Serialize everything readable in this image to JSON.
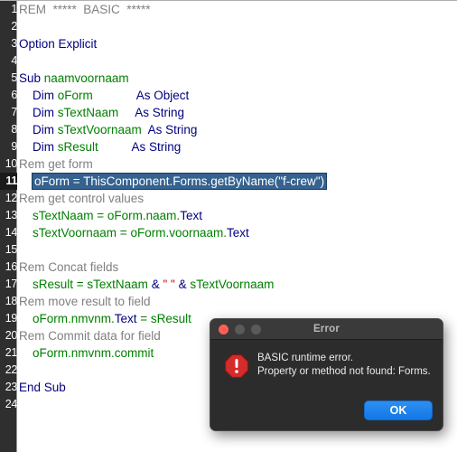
{
  "editor": {
    "name": "basic-code-editor",
    "colors": {
      "background": "#ffffff",
      "gutter_background": "#2f2f2f",
      "gutter_text": "#ffffff",
      "keyword": "#00007f",
      "identifier": "#008000",
      "comment": "#808080",
      "string": "#cc0000",
      "selection": "#35628f"
    },
    "active_line": 11,
    "lines": [
      {
        "no": "1",
        "tokens": [
          {
            "t": "REM  *****  BASIC  *****",
            "c": "rem"
          }
        ]
      },
      {
        "no": "2",
        "tokens": []
      },
      {
        "no": "3",
        "tokens": [
          {
            "t": "Option Explicit",
            "c": "kw"
          }
        ]
      },
      {
        "no": "4",
        "tokens": []
      },
      {
        "no": "5",
        "tokens": [
          {
            "t": "Sub ",
            "c": "kw"
          },
          {
            "t": "naamvoornaam",
            "c": "id"
          }
        ]
      },
      {
        "no": "6",
        "tokens": [
          {
            "t": "    Dim ",
            "c": "kw"
          },
          {
            "t": "oForm",
            "c": "id"
          },
          {
            "t": "             ",
            "c": "op"
          },
          {
            "t": "As Object",
            "c": "kw"
          }
        ]
      },
      {
        "no": "7",
        "tokens": [
          {
            "t": "    Dim ",
            "c": "kw"
          },
          {
            "t": "sTextNaam",
            "c": "id"
          },
          {
            "t": "     ",
            "c": "op"
          },
          {
            "t": "As String",
            "c": "kw"
          }
        ]
      },
      {
        "no": "8",
        "tokens": [
          {
            "t": "    Dim ",
            "c": "kw"
          },
          {
            "t": "sTextVoornaam",
            "c": "id"
          },
          {
            "t": "  ",
            "c": "op"
          },
          {
            "t": "As String",
            "c": "kw"
          }
        ]
      },
      {
        "no": "9",
        "tokens": [
          {
            "t": "    Dim ",
            "c": "kw"
          },
          {
            "t": "sResult",
            "c": "id"
          },
          {
            "t": "          ",
            "c": "op"
          },
          {
            "t": "As String",
            "c": "kw"
          }
        ]
      },
      {
        "no": "10",
        "tokens": [
          {
            "t": "Rem get form",
            "c": "rem"
          }
        ]
      },
      {
        "no": "11",
        "selected": true,
        "sel_indent": "    ",
        "tokens": [
          {
            "t": "oForm = ThisComponent.Forms.getByName(\"f-crew\")",
            "c": "id"
          }
        ]
      },
      {
        "no": "12",
        "tokens": [
          {
            "t": "Rem get control values",
            "c": "rem"
          }
        ]
      },
      {
        "no": "13",
        "tokens": [
          {
            "t": "    sTextNaam = oForm.naam.",
            "c": "id"
          },
          {
            "t": "Text",
            "c": "kw"
          }
        ]
      },
      {
        "no": "14",
        "tokens": [
          {
            "t": "    sTextVoornaam = oForm.voornaam.",
            "c": "id"
          },
          {
            "t": "Text",
            "c": "kw"
          }
        ]
      },
      {
        "no": "15",
        "tokens": []
      },
      {
        "no": "16",
        "tokens": [
          {
            "t": "Rem Concat fields",
            "c": "rem"
          }
        ]
      },
      {
        "no": "17",
        "tokens": [
          {
            "t": "    sResult = sTextNaam ",
            "c": "id"
          },
          {
            "t": "&",
            "c": "kw"
          },
          {
            "t": " ",
            "c": "id"
          },
          {
            "t": "\" \"",
            "c": "str"
          },
          {
            "t": " ",
            "c": "id"
          },
          {
            "t": "&",
            "c": "kw"
          },
          {
            "t": " sTextVoornaam",
            "c": "id"
          }
        ]
      },
      {
        "no": "18",
        "tokens": [
          {
            "t": "Rem move result to field",
            "c": "rem"
          }
        ]
      },
      {
        "no": "19",
        "tokens": [
          {
            "t": "    oForm.nmvnm.",
            "c": "id"
          },
          {
            "t": "Text",
            "c": "kw"
          },
          {
            "t": " = sResult",
            "c": "id"
          }
        ]
      },
      {
        "no": "20",
        "tokens": [
          {
            "t": "Rem Commit data for field",
            "c": "rem"
          }
        ]
      },
      {
        "no": "21",
        "tokens": [
          {
            "t": "    oForm.nmvnm.commit",
            "c": "id"
          }
        ]
      },
      {
        "no": "22",
        "tokens": []
      },
      {
        "no": "23",
        "tokens": [
          {
            "t": "End Sub",
            "c": "kw"
          }
        ]
      },
      {
        "no": "24",
        "tokens": []
      }
    ]
  },
  "dialog": {
    "title": "Error",
    "icon": "error-stop-icon",
    "message_line1": "BASIC runtime error.",
    "message_line2": "Property or method not found: Forms.",
    "ok_label": "OK",
    "colors": {
      "window": "#2c2c2c",
      "titlebar": "#3a3a3a",
      "close_button": "#ff5f57",
      "disabled_button": "#5a5a5a",
      "ok_button": "#1278e8",
      "icon": "#d82c2c"
    }
  }
}
